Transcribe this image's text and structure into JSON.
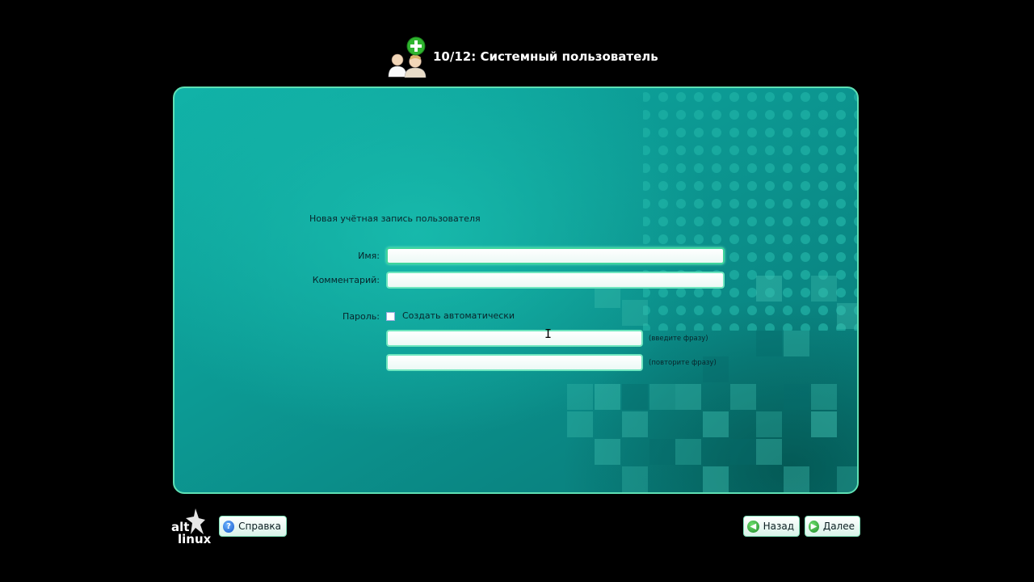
{
  "header": {
    "title": "10/12: Системный пользователь",
    "icon": "add-users-icon"
  },
  "form": {
    "section_title": "Новая учётная запись пользователя",
    "name_label": "Имя:",
    "name_value": "",
    "comment_label": "Комментарий:",
    "comment_value": "",
    "password_label": "Пароль:",
    "auto_password_label": "Создать автоматически",
    "auto_password_checked": false,
    "password_value": "",
    "password_hint": "(введите фразу)",
    "password_repeat_value": "",
    "password_repeat_hint": "(повторите фразу)"
  },
  "footer": {
    "logo_text_top": "alt",
    "logo_text_bottom": "linux",
    "help_label": "Справка",
    "back_label": "Назад",
    "next_label": "Далее"
  },
  "colors": {
    "background": "#000000",
    "panel": "#0e9e98",
    "panel_border": "#5fe0b4",
    "field_border": "#6fe6bf"
  }
}
